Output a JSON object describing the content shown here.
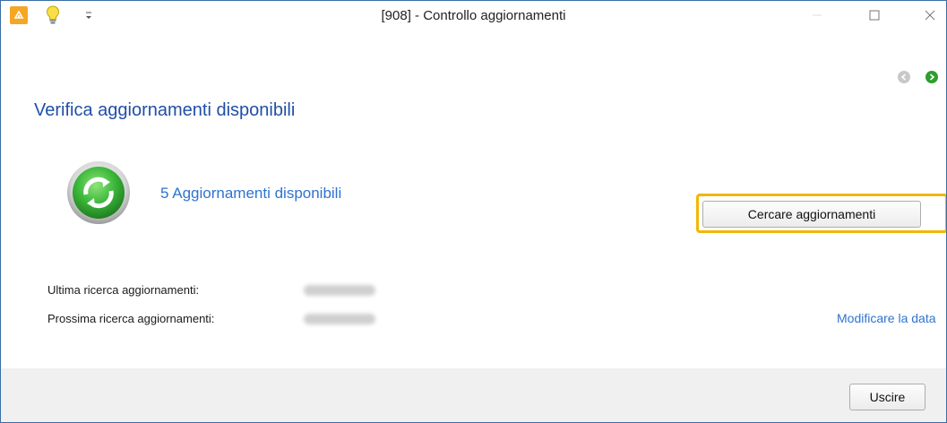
{
  "window": {
    "title": "[908] - Controllo aggiornamenti",
    "accent": "#3a6ea5"
  },
  "titlebar": {
    "icons": [
      "app-logo-icon",
      "lightbulb-icon",
      "quick-access-menu-icon"
    ],
    "controls": [
      "minimize-icon",
      "maximize-icon",
      "close-icon"
    ],
    "qa_glyph": "⩮"
  },
  "nav": {
    "icons": [
      "back-arrow-icon",
      "forward-arrow-icon"
    ],
    "forward_color": "#2e9e2e",
    "back_color": "#c8c8c8"
  },
  "main": {
    "heading": "Verifica aggiornamenti disponibili",
    "status_icon": "refresh-update-icon",
    "updates_available": "5 Aggiornamenti disponibili",
    "check_button": "Cercare aggiornamenti",
    "highlight_color": "#f2b705",
    "last_check_label": "Ultima ricerca aggiornamenti:",
    "next_check_label": "Prossima ricerca aggiornamenti:",
    "modify_date_link": "Modificare la data",
    "link_color": "#2f73d0",
    "heading_color": "#1f4fa8"
  },
  "footer": {
    "exit_button": "Uscire"
  }
}
